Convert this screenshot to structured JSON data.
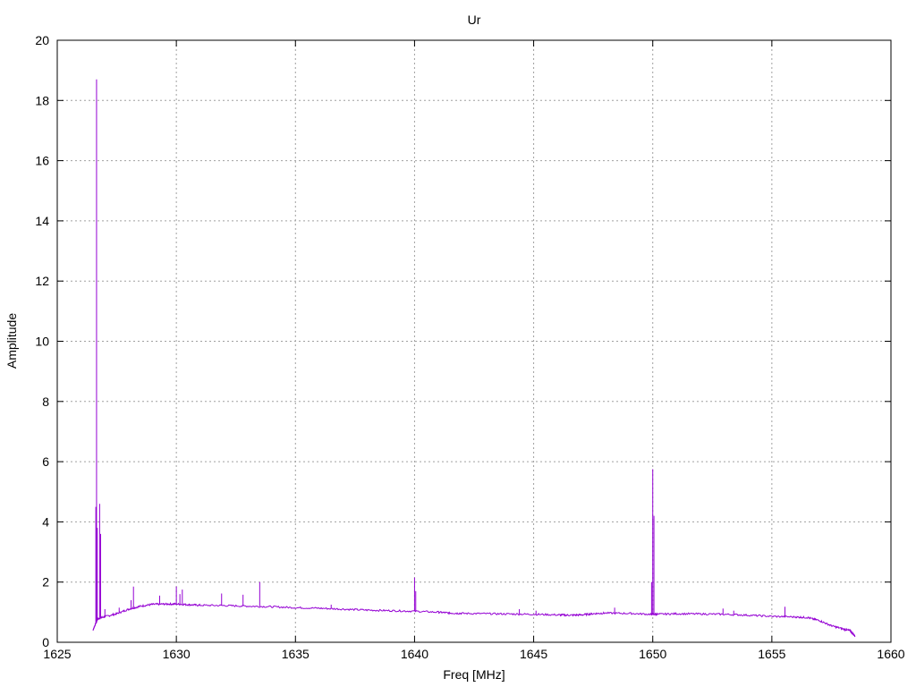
{
  "chart_data": {
    "type": "line",
    "title": "Ur",
    "xlabel": "Freq [MHz]",
    "ylabel": "Amplitude",
    "xlim": [
      1625,
      1660
    ],
    "ylim": [
      0,
      20
    ],
    "xticks": [
      1625,
      1630,
      1635,
      1640,
      1645,
      1650,
      1655,
      1660
    ],
    "yticks": [
      0,
      2,
      4,
      6,
      8,
      10,
      12,
      14,
      16,
      18,
      20
    ],
    "grid": true,
    "legend": "none",
    "colors": {
      "series": "#9400d3",
      "grid": "#a0a0a0",
      "axis": "#000000"
    },
    "series": [
      {
        "x": [
          1626.5,
          1626.6,
          1626.7,
          1627.0,
          1627.5,
          1628.0,
          1628.5,
          1629.0,
          1629.5,
          1630.0,
          1630.5,
          1631.0,
          1632.0,
          1633.0,
          1634.0,
          1635.0,
          1636.0,
          1637.0,
          1638.0,
          1639.0,
          1640.0,
          1641.0,
          1641.5,
          1642.0,
          1643.0,
          1644.0,
          1645.0,
          1646.0,
          1646.5,
          1647.0,
          1647.5,
          1648.0,
          1649.0,
          1649.9,
          1650.2,
          1651.0,
          1652.0,
          1653.0,
          1654.0,
          1655.0,
          1656.0,
          1656.5,
          1657.0,
          1657.5,
          1658.0,
          1658.3,
          1658.5
        ],
        "y": [
          0.4,
          0.6,
          0.78,
          0.85,
          0.95,
          1.1,
          1.2,
          1.26,
          1.27,
          1.27,
          1.25,
          1.23,
          1.22,
          1.2,
          1.18,
          1.15,
          1.13,
          1.1,
          1.07,
          1.05,
          1.03,
          1.0,
          0.97,
          0.96,
          0.95,
          0.94,
          0.93,
          0.91,
          0.9,
          0.91,
          0.95,
          0.97,
          0.96,
          0.93,
          0.93,
          0.95,
          0.94,
          0.93,
          0.9,
          0.86,
          0.84,
          0.82,
          0.72,
          0.55,
          0.44,
          0.38,
          0.2
        ]
      }
    ],
    "spikes": [
      {
        "x": 1626.65,
        "y": 18.7
      },
      {
        "x": 1626.62,
        "y": 4.5
      },
      {
        "x": 1626.68,
        "y": 3.8
      },
      {
        "x": 1626.78,
        "y": 4.6
      },
      {
        "x": 1626.82,
        "y": 3.6
      },
      {
        "x": 1627.0,
        "y": 1.1
      },
      {
        "x": 1627.6,
        "y": 1.15
      },
      {
        "x": 1628.2,
        "y": 1.85
      },
      {
        "x": 1628.1,
        "y": 1.4
      },
      {
        "x": 1629.3,
        "y": 1.55
      },
      {
        "x": 1630.0,
        "y": 1.85
      },
      {
        "x": 1630.15,
        "y": 1.6
      },
      {
        "x": 1630.25,
        "y": 1.75
      },
      {
        "x": 1631.9,
        "y": 1.62
      },
      {
        "x": 1632.8,
        "y": 1.58
      },
      {
        "x": 1633.5,
        "y": 2.0
      },
      {
        "x": 1636.5,
        "y": 1.25
      },
      {
        "x": 1640.0,
        "y": 2.15
      },
      {
        "x": 1640.05,
        "y": 1.7
      },
      {
        "x": 1644.4,
        "y": 1.1
      },
      {
        "x": 1645.1,
        "y": 1.05
      },
      {
        "x": 1648.4,
        "y": 1.15
      },
      {
        "x": 1649.95,
        "y": 2.0
      },
      {
        "x": 1650.0,
        "y": 5.75
      },
      {
        "x": 1650.05,
        "y": 4.2
      },
      {
        "x": 1652.95,
        "y": 1.12
      },
      {
        "x": 1653.4,
        "y": 1.05
      },
      {
        "x": 1655.55,
        "y": 1.18
      }
    ]
  }
}
